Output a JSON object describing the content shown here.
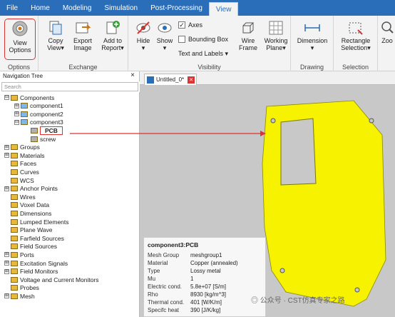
{
  "menu": {
    "tabs": [
      "File",
      "Home",
      "Modeling",
      "Simulation",
      "Post-Processing",
      "View"
    ],
    "active": "View"
  },
  "ribbon": {
    "options": {
      "view_options": "View\nOptions",
      "group": "Options"
    },
    "exchange": {
      "copy_view": "Copy\nView▾",
      "export_image": "Export\nImage",
      "add_to_report": "Add to\nReport▾",
      "group": "Exchange"
    },
    "visibility": {
      "hide": "Hide\n▾",
      "show": "Show\n▾",
      "axes": "Axes",
      "bounding_box": "Bounding Box",
      "text_labels": "Text and Labels ▾",
      "wire_frame": "Wire\nFrame",
      "working_plane": "Working\nPlane▾",
      "group": "Visibility"
    },
    "drawing": {
      "dimension": "Dimension\n▾",
      "group": "Drawing"
    },
    "selection": {
      "rectangle_selection": "Rectangle\nSelection▾",
      "group": "Selection"
    },
    "zoom": {
      "label": "Zoo"
    }
  },
  "nav": {
    "title": "Navigation Tree",
    "close": "×",
    "search_placeholder": "Search"
  },
  "tree": [
    {
      "label": "Components",
      "level": 0,
      "exp": "⊟"
    },
    {
      "label": "component1",
      "level": 1,
      "exp": "⊞"
    },
    {
      "label": "component2",
      "level": 1,
      "exp": "⊞"
    },
    {
      "label": "component3",
      "level": 1,
      "exp": "⊟"
    },
    {
      "label": "PCB",
      "level": 2,
      "exp": ""
    },
    {
      "label": "screw",
      "level": 2,
      "exp": ""
    },
    {
      "label": "Groups",
      "level": 0,
      "exp": "⊞"
    },
    {
      "label": "Materials",
      "level": 0,
      "exp": "⊞"
    },
    {
      "label": "Faces",
      "level": 0,
      "exp": ""
    },
    {
      "label": "Curves",
      "level": 0,
      "exp": ""
    },
    {
      "label": "WCS",
      "level": 0,
      "exp": ""
    },
    {
      "label": "Anchor Points",
      "level": 0,
      "exp": "⊞"
    },
    {
      "label": "Wires",
      "level": 0,
      "exp": ""
    },
    {
      "label": "Voxel Data",
      "level": 0,
      "exp": ""
    },
    {
      "label": "Dimensions",
      "level": 0,
      "exp": ""
    },
    {
      "label": "Lumped Elements",
      "level": 0,
      "exp": ""
    },
    {
      "label": "Plane Wave",
      "level": 0,
      "exp": ""
    },
    {
      "label": "Farfield Sources",
      "level": 0,
      "exp": ""
    },
    {
      "label": "Field Sources",
      "level": 0,
      "exp": ""
    },
    {
      "label": "Ports",
      "level": 0,
      "exp": "⊞"
    },
    {
      "label": "Excitation Signals",
      "level": 0,
      "exp": "⊞"
    },
    {
      "label": "Field Monitors",
      "level": 0,
      "exp": "⊞"
    },
    {
      "label": "Voltage and Current Monitors",
      "level": 0,
      "exp": ""
    },
    {
      "label": "Probes",
      "level": 0,
      "exp": ""
    },
    {
      "label": "Mesh",
      "level": 0,
      "exp": "⊞"
    }
  ],
  "doc": {
    "tab_label": "Untitled_0*",
    "tab_close": "✕"
  },
  "info": {
    "title": "component3:PCB",
    "rows": [
      {
        "k": "Mesh Group",
        "v": "meshgroup1"
      },
      {
        "k": "Material",
        "v": "Copper (annealed)"
      },
      {
        "k": "Type",
        "v": "Lossy metal"
      },
      {
        "k": "Mu",
        "v": "1"
      },
      {
        "k": "Electric cond.",
        "v": "5.8e+07 [S/m]"
      },
      {
        "k": "Rho",
        "v": "8930 [kg/m^3]"
      },
      {
        "k": "Thermal cond.",
        "v": "401 [W/K/m]"
      },
      {
        "k": "Specifc heat",
        "v": "390 [J/K/kg]"
      }
    ]
  },
  "watermark": "◎ 公众号 · CST仿真专家之路",
  "colors": {
    "accent": "#2a6db8",
    "highlight": "#d33333",
    "pcb": "#f7f200"
  }
}
